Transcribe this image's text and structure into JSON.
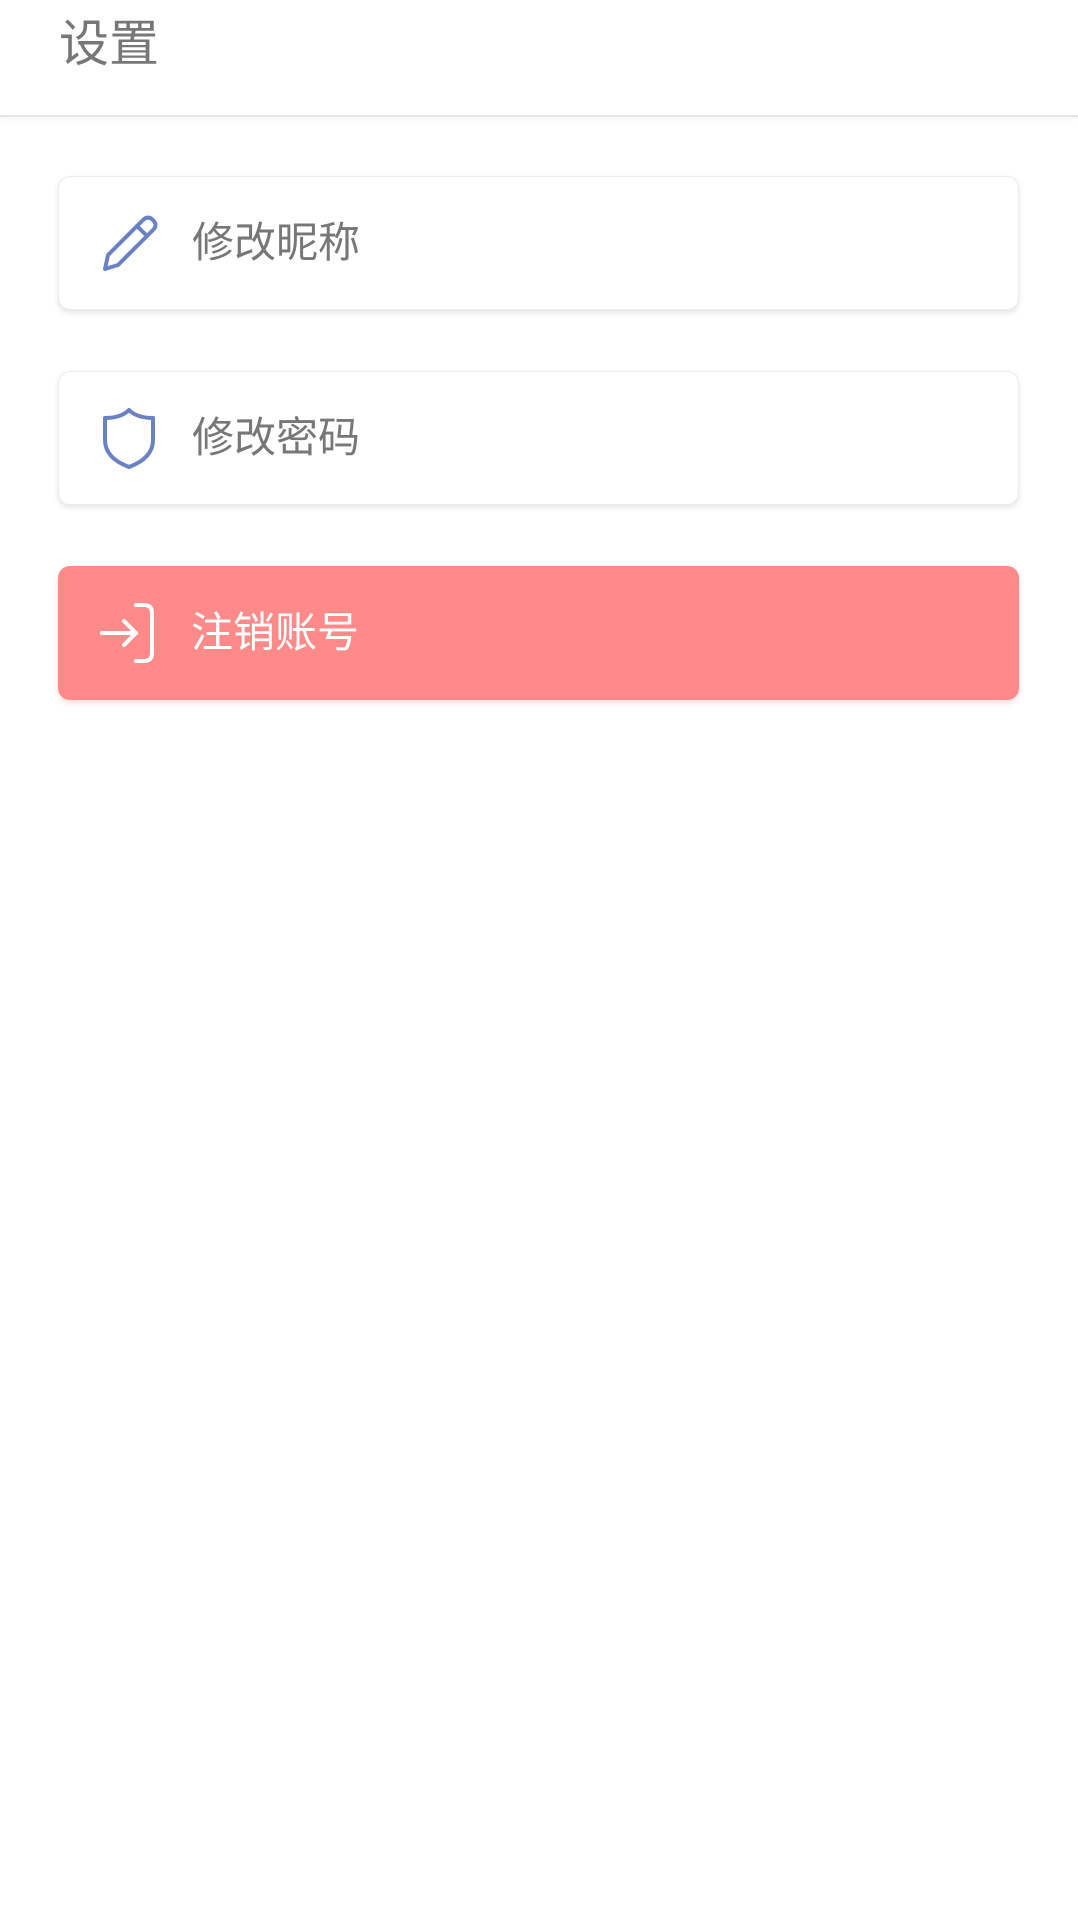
{
  "header": {
    "title": "设置"
  },
  "menu": {
    "items": [
      {
        "label": "修改昵称",
        "icon": "pencil-icon",
        "icon_color": "#6a82c4"
      },
      {
        "label": "修改密码",
        "icon": "shield-icon",
        "icon_color": "#6a82c4"
      },
      {
        "label": "注销账号",
        "icon": "logout-icon",
        "icon_color": "#ffffff",
        "background": "#ff8a8a"
      }
    ]
  }
}
